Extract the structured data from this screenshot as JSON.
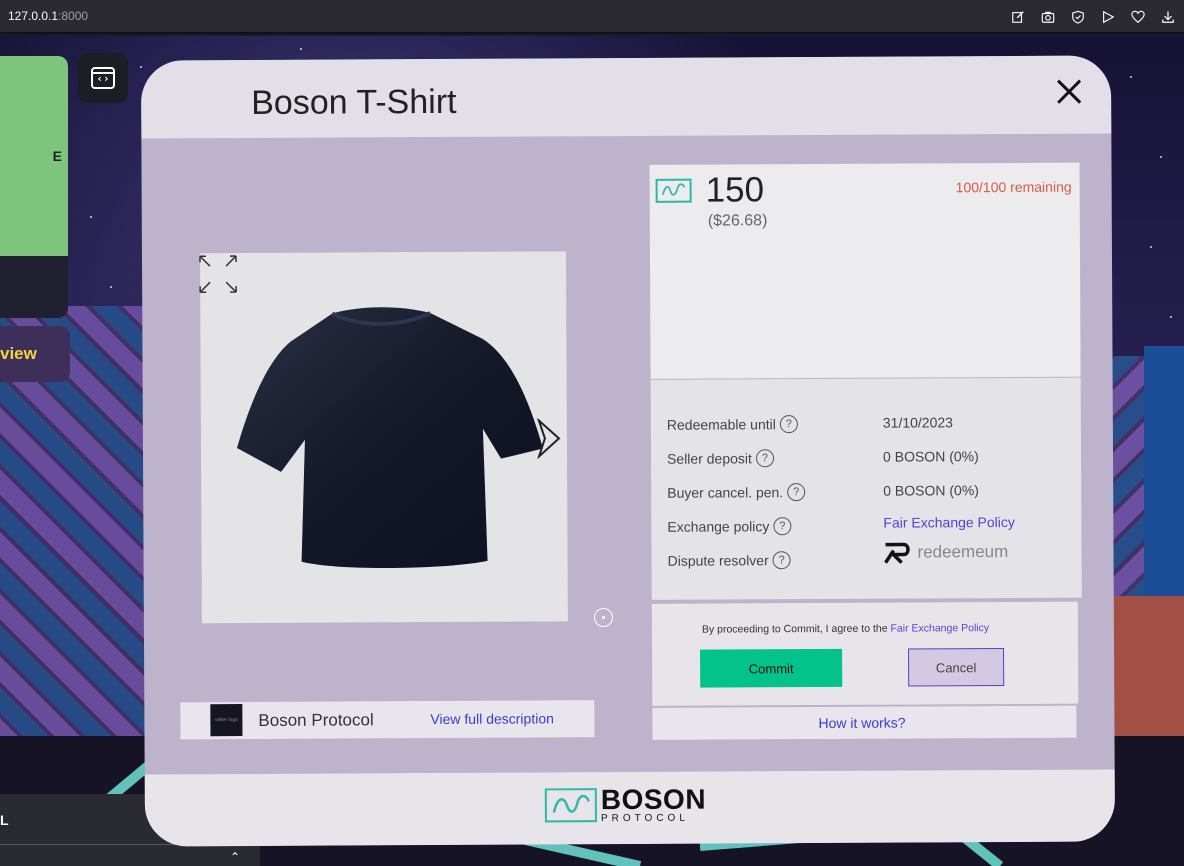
{
  "browser": {
    "url_host": "127.0.0.1",
    "url_port": ":8000",
    "icons": [
      "edit-icon",
      "camera-icon",
      "shield-icon",
      "send-icon",
      "heart-icon",
      "download-icon"
    ]
  },
  "scene": {
    "side_letter": "E",
    "view_label": "view",
    "bottom_panel_label": "L",
    "bottom_close": "✕",
    "chevron": "⌃"
  },
  "modal": {
    "title": "Boson T-Shirt",
    "seller": {
      "avatar_text": "seller logo",
      "name": "Boson Protocol",
      "view_description": "View full description"
    },
    "price": {
      "value": "150",
      "usd": "($26.68)",
      "remaining": "100/100 remaining"
    },
    "details": [
      {
        "label": "Redeemable until",
        "value": "31/10/2023"
      },
      {
        "label": "Seller deposit",
        "value": "0 BOSON (0%)"
      },
      {
        "label": "Buyer cancel. pen.",
        "value": "0 BOSON (0%)"
      },
      {
        "label": "Exchange policy",
        "value": "Fair Exchange Policy"
      },
      {
        "label": "Dispute resolver",
        "value": "redeemeum"
      }
    ],
    "agree_text": "By proceeding to Commit, I agree to the",
    "agree_link": "Fair Exchange Policy",
    "commit_label": "Commit",
    "cancel_label": "Cancel",
    "how_it_works": "How it works?",
    "footer": {
      "brand_top": "BOSON",
      "brand_bottom": "PROTOCOL"
    }
  },
  "colors": {
    "commit": "#03c28a",
    "remaining": "#d75b45",
    "link": "#3a3ad0",
    "accent": "#5a3fd0",
    "logo_teal": "#2fb8a5"
  }
}
